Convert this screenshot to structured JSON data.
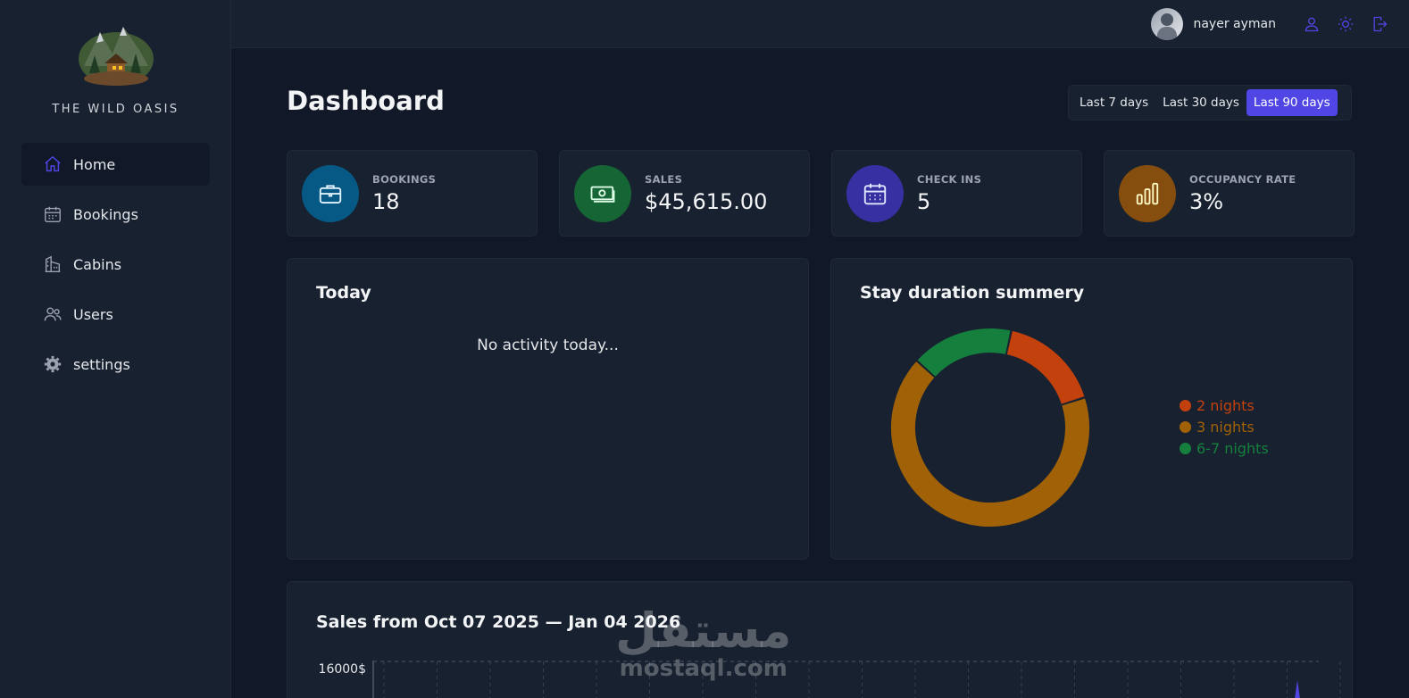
{
  "brand": {
    "name": "THE WILD OASIS"
  },
  "nav": {
    "items": [
      {
        "label": "Home",
        "icon": "home-icon",
        "active": true
      },
      {
        "label": "Bookings",
        "icon": "calendar-icon",
        "active": false
      },
      {
        "label": "Cabins",
        "icon": "building-icon",
        "active": false
      },
      {
        "label": "Users",
        "icon": "users-icon",
        "active": false
      },
      {
        "label": "settings",
        "icon": "gear-icon",
        "active": false
      }
    ]
  },
  "header": {
    "user_name": "nayer ayman"
  },
  "page": {
    "title": "Dashboard"
  },
  "filter": {
    "options": [
      "Last 7 days",
      "Last 30 days",
      "Last 90 days"
    ],
    "selected": "Last 90 days"
  },
  "stats": [
    {
      "label": "BOOKINGS",
      "value": "18",
      "icon": "briefcase-icon",
      "color": "#075985"
    },
    {
      "label": "SALES",
      "value": "$45,615.00",
      "icon": "banknotes-icon",
      "color": "#166534"
    },
    {
      "label": "CHECK INS",
      "value": "5",
      "icon": "calendar-days-icon",
      "color": "#3730a3"
    },
    {
      "label": "OCCUPANCY RATE",
      "value": "3%",
      "icon": "chart-bar-icon",
      "color": "#854d0e"
    }
  ],
  "today": {
    "title": "Today",
    "empty_text": "No activity today..."
  },
  "duration": {
    "title": "Stay duration summery"
  },
  "sales": {
    "title": "Sales from Oct 07 2025 — Jan 04 2026"
  },
  "watermark": {
    "arabic": "مستقل",
    "latin": "mostaql.com"
  },
  "chart_data": [
    {
      "type": "pie",
      "title": "Stay duration summery",
      "categories": [
        "2 nights",
        "3 nights",
        "6-7 nights"
      ],
      "values": [
        3,
        12,
        3
      ],
      "colors": [
        "#c2410c",
        "#a16207",
        "#15803d"
      ],
      "legend": "right"
    },
    {
      "type": "area",
      "title": "Sales from Oct 07 2025 — Jan 04 2026",
      "y_tick_labels": [
        "16000$"
      ],
      "grid": true
    }
  ]
}
